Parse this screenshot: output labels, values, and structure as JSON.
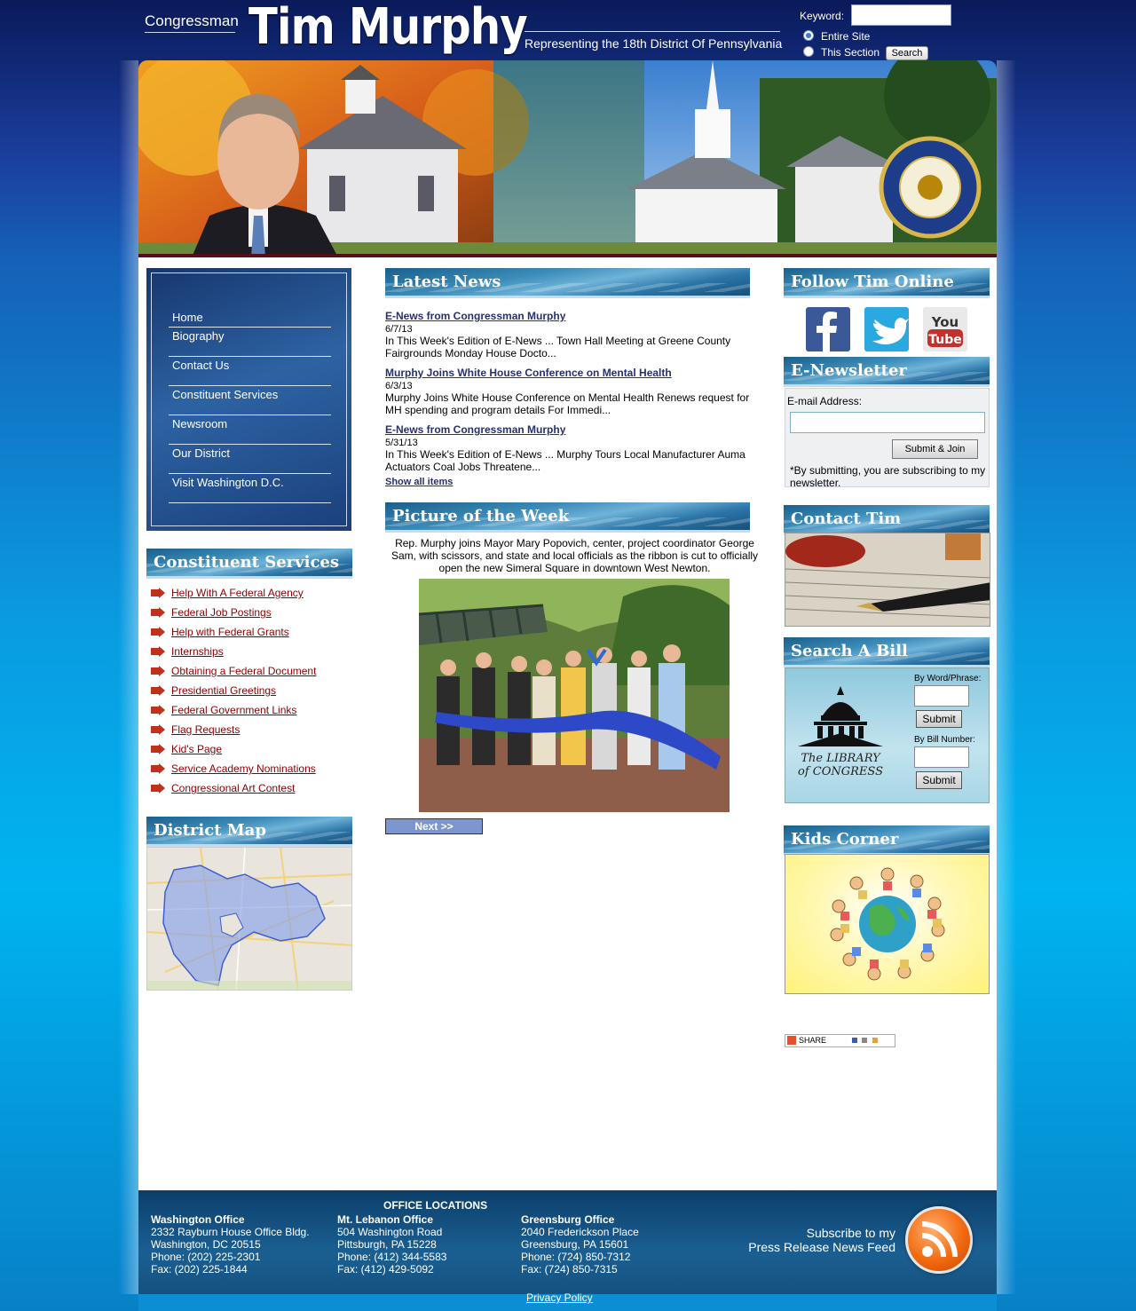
{
  "header": {
    "prefix": "Congressman",
    "name": "Tim Murphy",
    "tagline": "Representing the 18th District Of Pennsylvania",
    "search": {
      "keyword_label": "Keyword:",
      "keyword_value": "",
      "scope_options": [
        "Entire Site",
        "This Section"
      ],
      "selected_scope": "Entire Site",
      "button": "Search"
    }
  },
  "nav": {
    "items": [
      {
        "label": "Home"
      },
      {
        "label": "Biography"
      },
      {
        "label": "Contact Us"
      },
      {
        "label": "Constituent Services"
      },
      {
        "label": "Newsroom"
      },
      {
        "label": "Our District"
      },
      {
        "label": "Visit Washington D.C."
      }
    ]
  },
  "constituent_services": {
    "title": "Constituent Services",
    "links": [
      "Help With A Federal Agency",
      "Federal Job Postings",
      "Help with Federal Grants",
      "Internships",
      "Obtaining a Federal Document",
      "Presidential Greetings",
      "Federal Government Links",
      "Flag Requests",
      "Kid's Page",
      "Service Academy Nominations",
      "Congressional Art Contest"
    ]
  },
  "district_map": {
    "title": "District Map"
  },
  "latest_news": {
    "title": "Latest News",
    "items": [
      {
        "title": "E-News from Congressman Murphy",
        "date": "6/7/13",
        "summary": "In This Week's Edition of E-News ... Town Hall Meeting at Greene County Fairgrounds Monday House Docto..."
      },
      {
        "title": "Murphy Joins White House Conference on Mental Health",
        "date": "6/3/13",
        "summary": "Murphy Joins White House Conference on Mental Health Renews request for MH spending and program details For Immedi..."
      },
      {
        "title": "E-News from Congressman Murphy",
        "date": "5/31/13",
        "summary": "In This Week's Edition of E-News ... Murphy Tours Local Manufacturer Auma Actuators Coal Jobs Threatene..."
      }
    ],
    "show_all": "Show all items"
  },
  "picture_of_week": {
    "title": "Picture of the Week",
    "caption": "Rep. Murphy joins Mayor Mary Popovich, center, project coordinator George Sam, with scissors, and state and local officials as the ribbon is cut to officially open the new Simeral Square in downtown West Newton.",
    "next": "Next >>"
  },
  "follow": {
    "title": "Follow Tim Online",
    "networks": [
      "facebook-icon",
      "twitter-icon",
      "youtube-icon"
    ]
  },
  "enewsletter": {
    "title": "E-Newsletter",
    "email_label": "E-mail Address:",
    "email_value": "",
    "button": "Submit & Join",
    "note": "*By submitting, you are subscribing to my newsletter."
  },
  "contact": {
    "title": "Contact Tim"
  },
  "bill_search": {
    "title": "Search A Bill",
    "logo_line1": "The LIBRARY",
    "logo_line2": "of CONGRESS",
    "word_label": "By Word/Phrase:",
    "number_label": "By Bill Number:",
    "submit": "Submit"
  },
  "kids": {
    "title": "Kids Corner"
  },
  "share": {
    "label": "SHARE"
  },
  "footer": {
    "heading": "OFFICE LOCATIONS",
    "offices": [
      {
        "name": "Washington Office",
        "lines": [
          "2332 Rayburn House Office Bldg.",
          "Washington, DC 20515",
          "Phone: (202) 225-2301",
          "Fax: (202) 225-1844"
        ]
      },
      {
        "name": "Mt. Lebanon Office",
        "lines": [
          "504 Washington Road",
          "Pittsburgh, PA 15228",
          "Phone: (412) 344-5583",
          "Fax: (412) 429-5092"
        ]
      },
      {
        "name": "Greensburg Office",
        "lines": [
          "2040 Frederickson Place",
          "Greensburg, PA 15601",
          "Phone: (724) 850-7312",
          "Fax: (724) 850-7315"
        ]
      }
    ],
    "subscribe_line1": "Subscribe to my",
    "subscribe_line2": "Press Release News Feed",
    "privacy": "Privacy Policy"
  },
  "colors": {
    "link_red": "#8b0000",
    "news_link": "#273070",
    "header_blue": "#0a1a5a"
  }
}
